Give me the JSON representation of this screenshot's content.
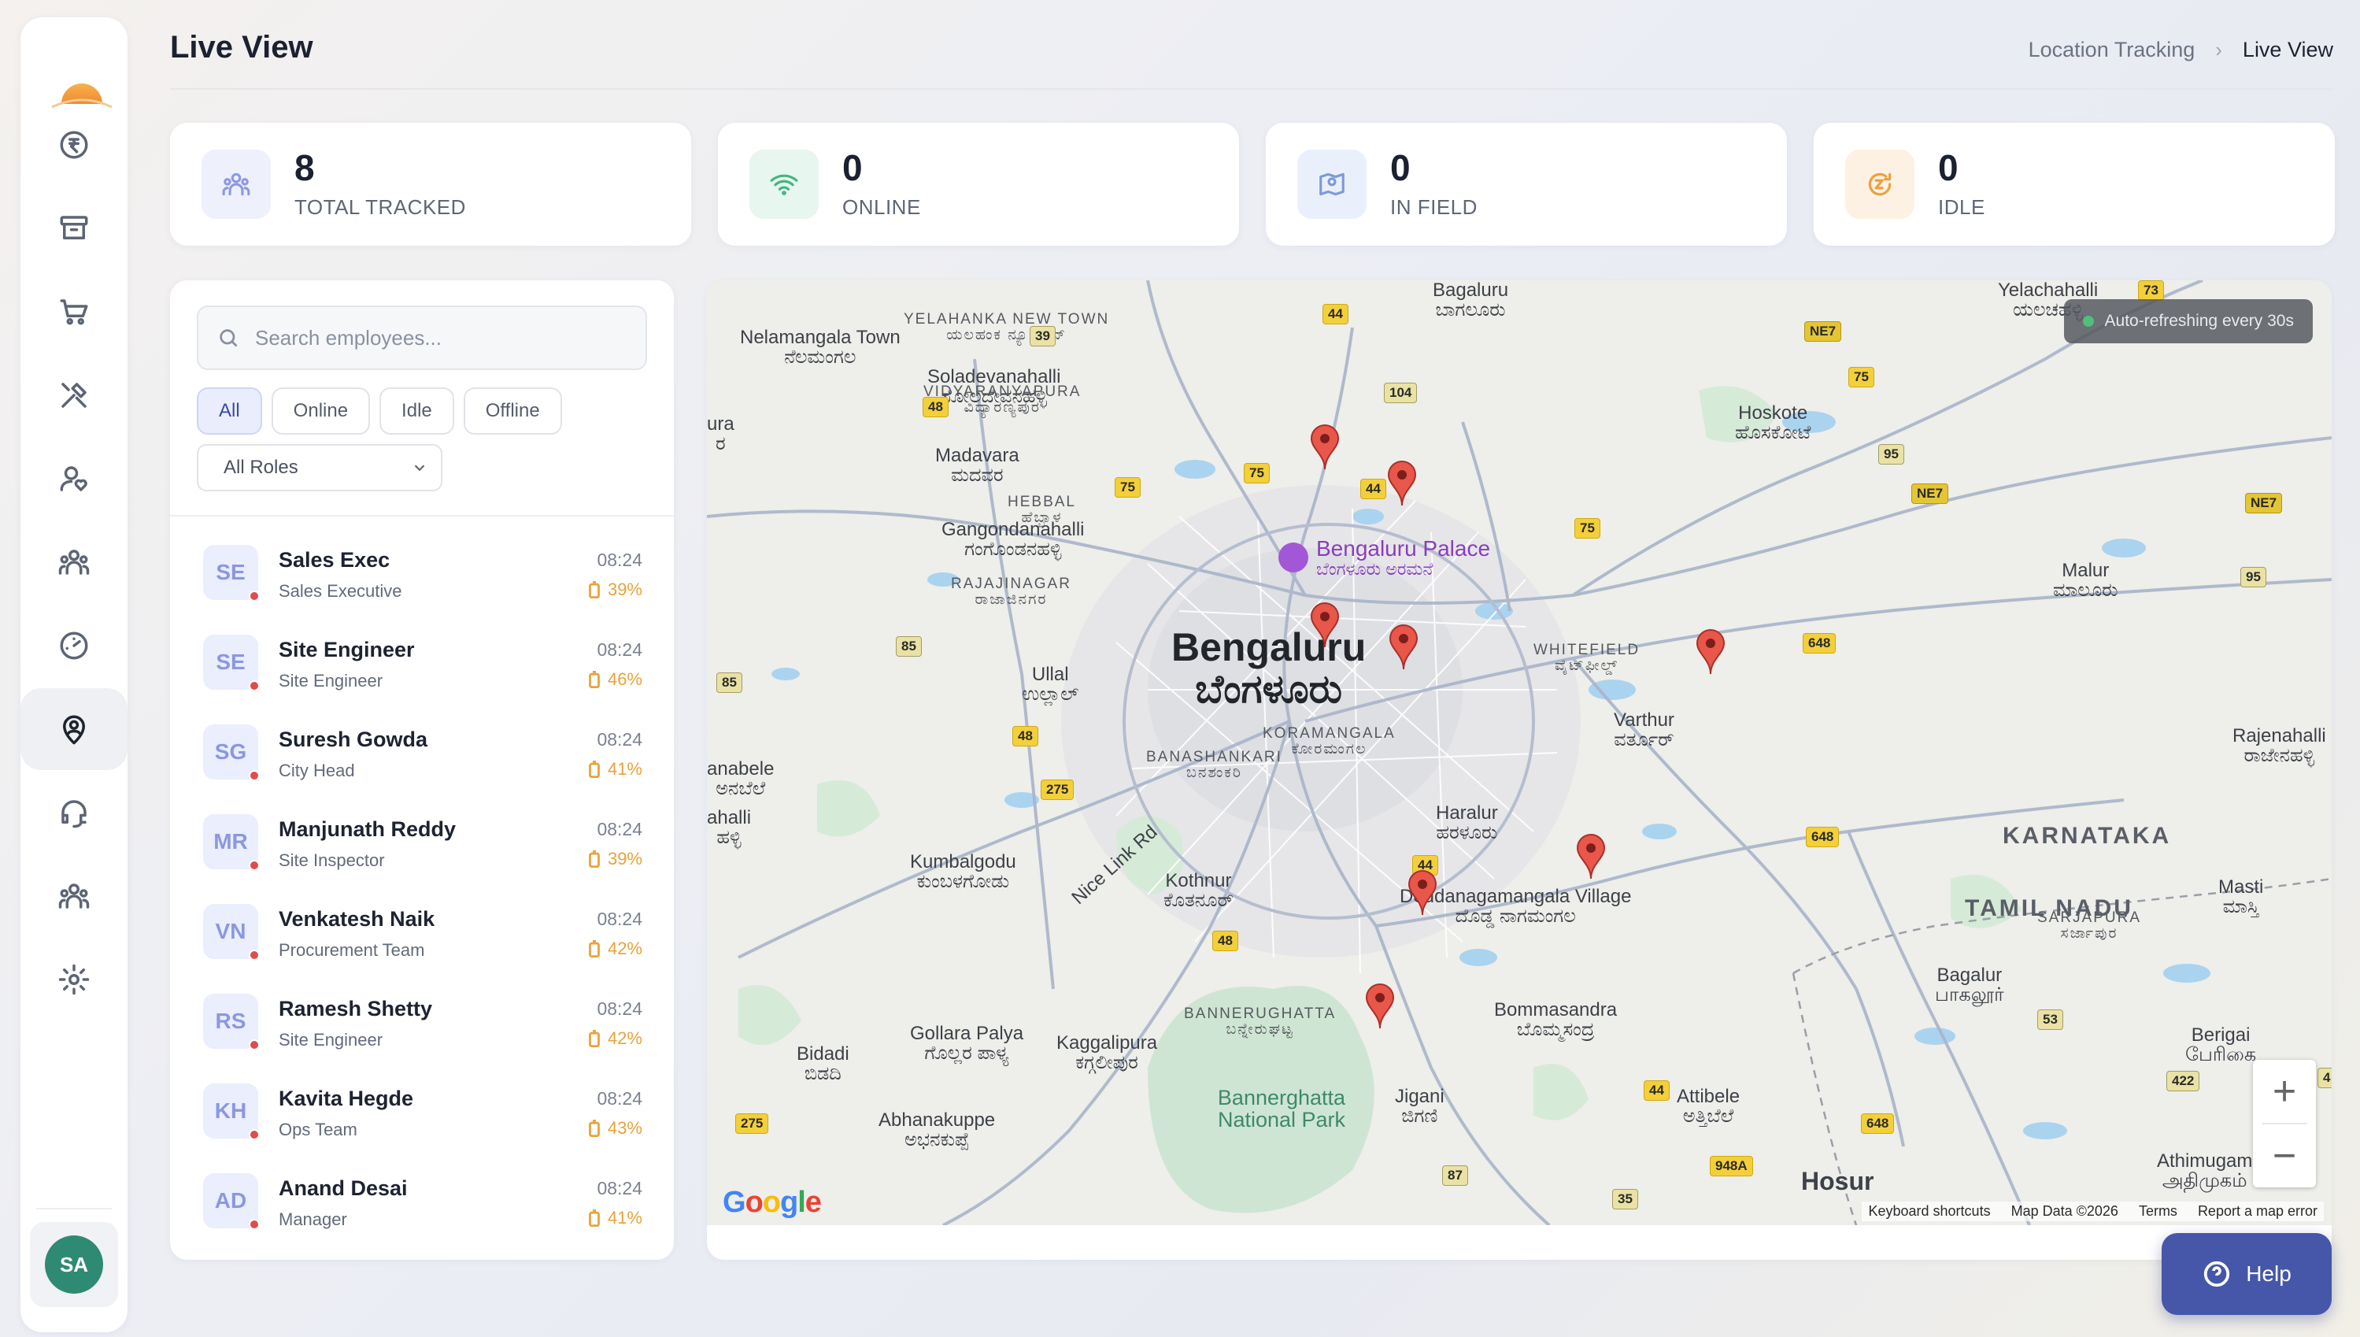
{
  "header": {
    "title": "Live View",
    "breadcrumb": {
      "parent": "Location Tracking",
      "current": "Live View"
    }
  },
  "sidebar": {
    "items": [
      {
        "icon": "rupee-icon",
        "active": false
      },
      {
        "icon": "archive-icon",
        "active": false
      },
      {
        "icon": "cart-icon",
        "active": false
      },
      {
        "icon": "tools-icon",
        "active": false
      },
      {
        "icon": "user-heart-icon",
        "active": false
      },
      {
        "icon": "team-icon",
        "active": false
      },
      {
        "icon": "gauge-icon",
        "active": false
      },
      {
        "icon": "location-user-icon",
        "active": true
      },
      {
        "icon": "headset-icon",
        "active": false
      },
      {
        "icon": "group-icon",
        "active": false
      },
      {
        "icon": "settings-icon",
        "active": false
      }
    ],
    "user_initials": "SA"
  },
  "stats": [
    {
      "value": "8",
      "label": "TOTAL TRACKED",
      "icon": "people-icon",
      "color": "#7f8fe0",
      "bg": "#eef0fc"
    },
    {
      "value": "0",
      "label": "ONLINE",
      "icon": "wifi-icon",
      "color": "#45b483",
      "bg": "#e7f6ef"
    },
    {
      "value": "0",
      "label": "IN FIELD",
      "icon": "map-pin-icon",
      "color": "#7d9ad8",
      "bg": "#eaf0fb"
    },
    {
      "value": "0",
      "label": "IDLE",
      "icon": "idle-icon",
      "color": "#eca13d",
      "bg": "#fdf1e3"
    }
  ],
  "employees_panel": {
    "search_placeholder": "Search employees...",
    "filters": [
      "All",
      "Online",
      "Idle",
      "Offline"
    ],
    "active_filter": "All",
    "role_select": "All Roles",
    "employees": [
      {
        "initials": "SE",
        "name": "Sales Exec",
        "role": "Sales Executive",
        "time": "08:24",
        "battery": "39%"
      },
      {
        "initials": "SE",
        "name": "Site Engineer",
        "role": "Site Engineer",
        "time": "08:24",
        "battery": "46%"
      },
      {
        "initials": "SG",
        "name": "Suresh Gowda",
        "role": "City Head",
        "time": "08:24",
        "battery": "41%"
      },
      {
        "initials": "MR",
        "name": "Manjunath Reddy",
        "role": "Site Inspector",
        "time": "08:24",
        "battery": "39%"
      },
      {
        "initials": "VN",
        "name": "Venkatesh Naik",
        "role": "Procurement Team",
        "time": "08:24",
        "battery": "42%"
      },
      {
        "initials": "RS",
        "name": "Ramesh Shetty",
        "role": "Site Engineer",
        "time": "08:24",
        "battery": "42%"
      },
      {
        "initials": "KH",
        "name": "Kavita Hegde",
        "role": "Ops Team",
        "time": "08:24",
        "battery": "43%"
      },
      {
        "initials": "AD",
        "name": "Anand Desai",
        "role": "Manager",
        "time": "08:24",
        "battery": "41%"
      }
    ]
  },
  "map": {
    "refresh_text": "Auto-refreshing every 30s",
    "city_en": "Bengaluru",
    "city_kn": "ಬೆಂಗಳೂರು",
    "palace_en": "Bengaluru Palace",
    "palace_kn": "ಬೆಂಗಳೂರು ಅರಮನೆ",
    "park": "Bannerghatta National Park",
    "google": "Google",
    "footer": {
      "shortcuts": "Keyboard shortcuts",
      "data": "Map Data ©2026",
      "terms": "Terms",
      "report": "Report a map error"
    },
    "zoom_in": "+",
    "zoom_out": "−",
    "places": [
      {
        "en": "Nelamangala Town",
        "kn": "ನೆಲಮಂಗಲ"
      },
      {
        "en": "Soladevanahalli",
        "kn": "ಸೋಲದೇವನಹಳ್ಳಿ"
      },
      {
        "en": "YELAHANKA NEW TOWN",
        "kn": "ಯಲಹಂಕ ನ್ಯೂ ಟೌನ್"
      },
      {
        "en": "VIDYARANYAPURA",
        "kn": "ವಿದ್ಯಾರಣ್ಯಪುರ"
      },
      {
        "en": "Madavara",
        "kn": "ಮದವರ"
      },
      {
        "en": "HEBBAL",
        "kn": "ಹೆಬ್ಬಾಳ"
      },
      {
        "en": "Hoskote",
        "kn": "ಹೊಸಕೋಟೆ"
      },
      {
        "en": "Gangondanahalli",
        "kn": "ಗಂಗೊಂಡನಹಳ್ಳಿ"
      },
      {
        "en": "RAJAJINAGAR",
        "kn": "ರಾಜಾಜಿನಗರ"
      },
      {
        "en": "Malur",
        "kn": "ಮಾಲೂರು"
      },
      {
        "en": "WHITEFIELD",
        "kn": "ವೈಟ್‌ಫೀಲ್ಡ್"
      },
      {
        "en": "Ullal",
        "kn": "ಉಲ್ಲಾಲ್"
      },
      {
        "en": "Varthur",
        "kn": "ವರ್ತೂರ್"
      },
      {
        "en": "BANASHANKARI",
        "kn": "ಬನಶಂಕರಿ"
      },
      {
        "en": "KORAMANGALA",
        "kn": "ಕೋರಮಂಗಲ"
      },
      {
        "en": "Rajenahalli",
        "kn": "ರಾಜೇನಹಳ್ಳಿ"
      },
      {
        "en": "Haralur",
        "kn": "ಹರಳೂರು"
      },
      {
        "en": "KARNATAKA",
        "kn": ""
      },
      {
        "en": "Kumbalgodu",
        "kn": "ಕುಂಬಳಗೋಡು"
      },
      {
        "en": "Kothnur",
        "kn": "ಕೊತನೂರ್"
      },
      {
        "en": "Doddanagamangala Village",
        "kn": "ದೊಡ್ಡ ನಾಗಮಂಗಲ"
      },
      {
        "en": "SARJAPURA",
        "kn": "ಸರ್ಜಾಪುರ"
      },
      {
        "en": "Masti",
        "kn": "ಮಾಸ್ತಿ"
      },
      {
        "en": "TAMIL NADU",
        "kn": ""
      },
      {
        "en": "Bagalur",
        "kn": "பாகலூர்"
      },
      {
        "en": "BANNERUGHATTA",
        "kn": "ಬನ್ನೇರುಘಟ್ಟ"
      },
      {
        "en": "Bommasandra",
        "kn": "ಬೊಮ್ಮಸಂದ್ರ"
      },
      {
        "en": "Bidadi",
        "kn": "ಬಿಡದಿ"
      },
      {
        "en": "Gollara Palya",
        "kn": "ಗೊಲ್ಲರ ಪಾಳ್ಯ"
      },
      {
        "en": "Kaggalipura",
        "kn": "ಕಗ್ಗಲೀಪುರ"
      },
      {
        "en": "Berigai",
        "kn": "பேரிகை"
      },
      {
        "en": "Attibele",
        "kn": "ಅತ್ತಿಬೆಲೆ"
      },
      {
        "en": "Jigani",
        "kn": "ಜಿಗಣಿ"
      },
      {
        "en": "Abhanakuppe",
        "kn": "ಅಭನಕುಪ್ಪೆ"
      },
      {
        "en": "Athimugam",
        "kn": "அதிமுகம்"
      },
      {
        "en": "Hosur",
        "kn": ""
      },
      {
        "en": "Nice Link Rd",
        "kn": ""
      },
      {
        "en": "Bagaluru",
        "kn": "ಬಾಗಲೂರು"
      },
      {
        "en": "Yelachahalli",
        "kn": "ಯಲಚಹಳ್ಳಿ"
      },
      {
        "en": "anabele",
        "kn": "ಅನಬೆಲೆ"
      },
      {
        "en": "ahalli",
        "kn": "ಹಳ್ಳಿ"
      },
      {
        "en": "ura",
        "kn": "ರ"
      }
    ]
  }
}
